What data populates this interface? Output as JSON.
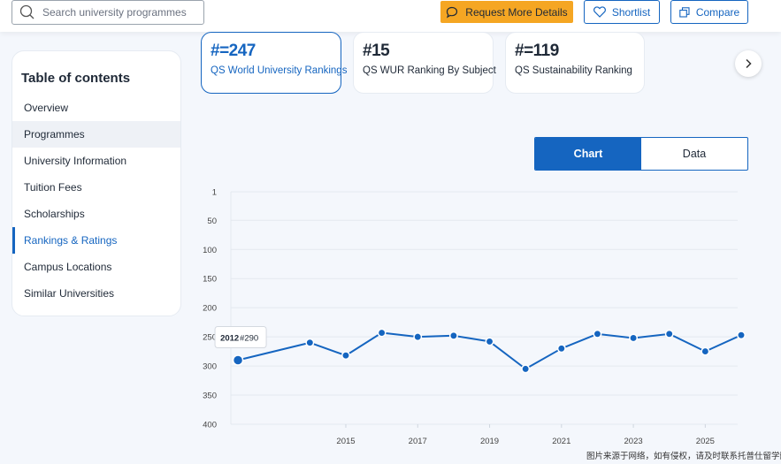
{
  "header": {
    "search_placeholder": "Search university programmes",
    "request_label": "Request More Details",
    "shortlist_label": "Shortlist",
    "compare_label": "Compare"
  },
  "toc": {
    "title": "Table of contents",
    "items": [
      {
        "label": "Overview"
      },
      {
        "label": "Programmes"
      },
      {
        "label": "University Information"
      },
      {
        "label": "Tuition Fees"
      },
      {
        "label": "Scholarships"
      },
      {
        "label": "Rankings & Ratings"
      },
      {
        "label": "Campus Locations"
      },
      {
        "label": "Similar Universities"
      }
    ],
    "active_index": 5
  },
  "rankings": [
    {
      "value": "#=247",
      "label": "QS World University Rankings",
      "selected": true
    },
    {
      "value": "#15",
      "label": "QS WUR Ranking By Subject",
      "selected": false
    },
    {
      "value": "#=119",
      "label": "QS Sustainability Ranking",
      "selected": false
    }
  ],
  "view_toggle": {
    "chart_label": "Chart",
    "data_label": "Data",
    "selected": "Chart"
  },
  "colors": {
    "accent": "#1565c0",
    "request_button": "#f5a623"
  },
  "chart_data": {
    "type": "line",
    "x": [
      2012,
      2014,
      2015,
      2016,
      2017,
      2018,
      2019,
      2020,
      2021,
      2022,
      2023,
      2024,
      2025,
      2026
    ],
    "series": [
      {
        "values": [
          290,
          260,
          282,
          243,
          250,
          248,
          258,
          305,
          270,
          245,
          252,
          245,
          275,
          247
        ]
      }
    ],
    "x_ticks": [
      "2015",
      "2017",
      "2019",
      "2021",
      "2023",
      "2025"
    ],
    "y_ticks": [
      "1",
      "50",
      "100",
      "150",
      "200",
      "250",
      "300",
      "350",
      "400"
    ],
    "ylim": [
      1,
      400
    ],
    "y_reversed": true,
    "grid": true,
    "tooltip": {
      "year": "2012",
      "rank": "#290"
    }
  },
  "watermark": "图片来源于网络，如有侵权，请及时联系托普仕留学删除"
}
